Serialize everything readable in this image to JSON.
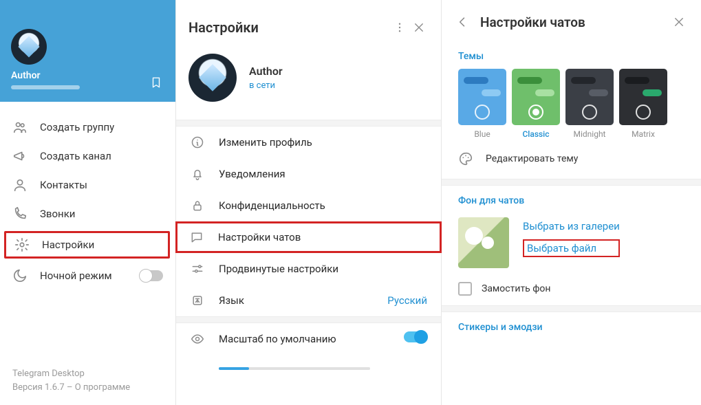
{
  "sidebar": {
    "name": "Author",
    "items": [
      {
        "icon": "group",
        "label": "Создать группу"
      },
      {
        "icon": "megaphone",
        "label": "Создать канал"
      },
      {
        "icon": "person",
        "label": "Контакты"
      },
      {
        "icon": "phone",
        "label": "Звонки"
      },
      {
        "icon": "gear",
        "label": "Настройки"
      },
      {
        "icon": "moon",
        "label": "Ночной режим"
      }
    ],
    "footer_app": "Telegram Desktop",
    "footer_version": "Версия 1.6.7 – О программе"
  },
  "middle": {
    "title": "Настройки",
    "profile_name": "Author",
    "profile_status": "в сети",
    "items": [
      {
        "icon": "info",
        "label": "Изменить профиль"
      },
      {
        "icon": "bell",
        "label": "Уведомления"
      },
      {
        "icon": "lock",
        "label": "Конфиденциальность"
      },
      {
        "icon": "chat",
        "label": "Настройки чатов"
      },
      {
        "icon": "sliders",
        "label": "Продвинутые настройки"
      },
      {
        "icon": "lang",
        "label": "Язык",
        "value": "Русский"
      }
    ],
    "scale_label": "Масштаб по умолчанию"
  },
  "right": {
    "title": "Настройки чатов",
    "themes_label": "Темы",
    "themes": [
      {
        "name": "Blue",
        "bg": "#59a9e6",
        "b1": "#2d7bc0",
        "b2": "#8ecaf3"
      },
      {
        "name": "Classic",
        "bg": "#6fbf6b",
        "b1": "#3b8f3b",
        "b2": "#a8e0a2"
      },
      {
        "name": "Midnight",
        "bg": "#3b3f46",
        "b1": "#23262b",
        "b2": "#585d66"
      },
      {
        "name": "Matrix",
        "bg": "#2d2f33",
        "b1": "#1a1c1f",
        "b2": "#2aa96d"
      }
    ],
    "selected_theme": 1,
    "edit_theme": "Редактировать тему",
    "bg_label": "Фон для чатов",
    "choose_gallery": "Выбрать из галереи",
    "choose_file": "Выбрать файл",
    "tile_label": "Замостить фон",
    "stickers_label": "Стикеры и эмодзи"
  }
}
